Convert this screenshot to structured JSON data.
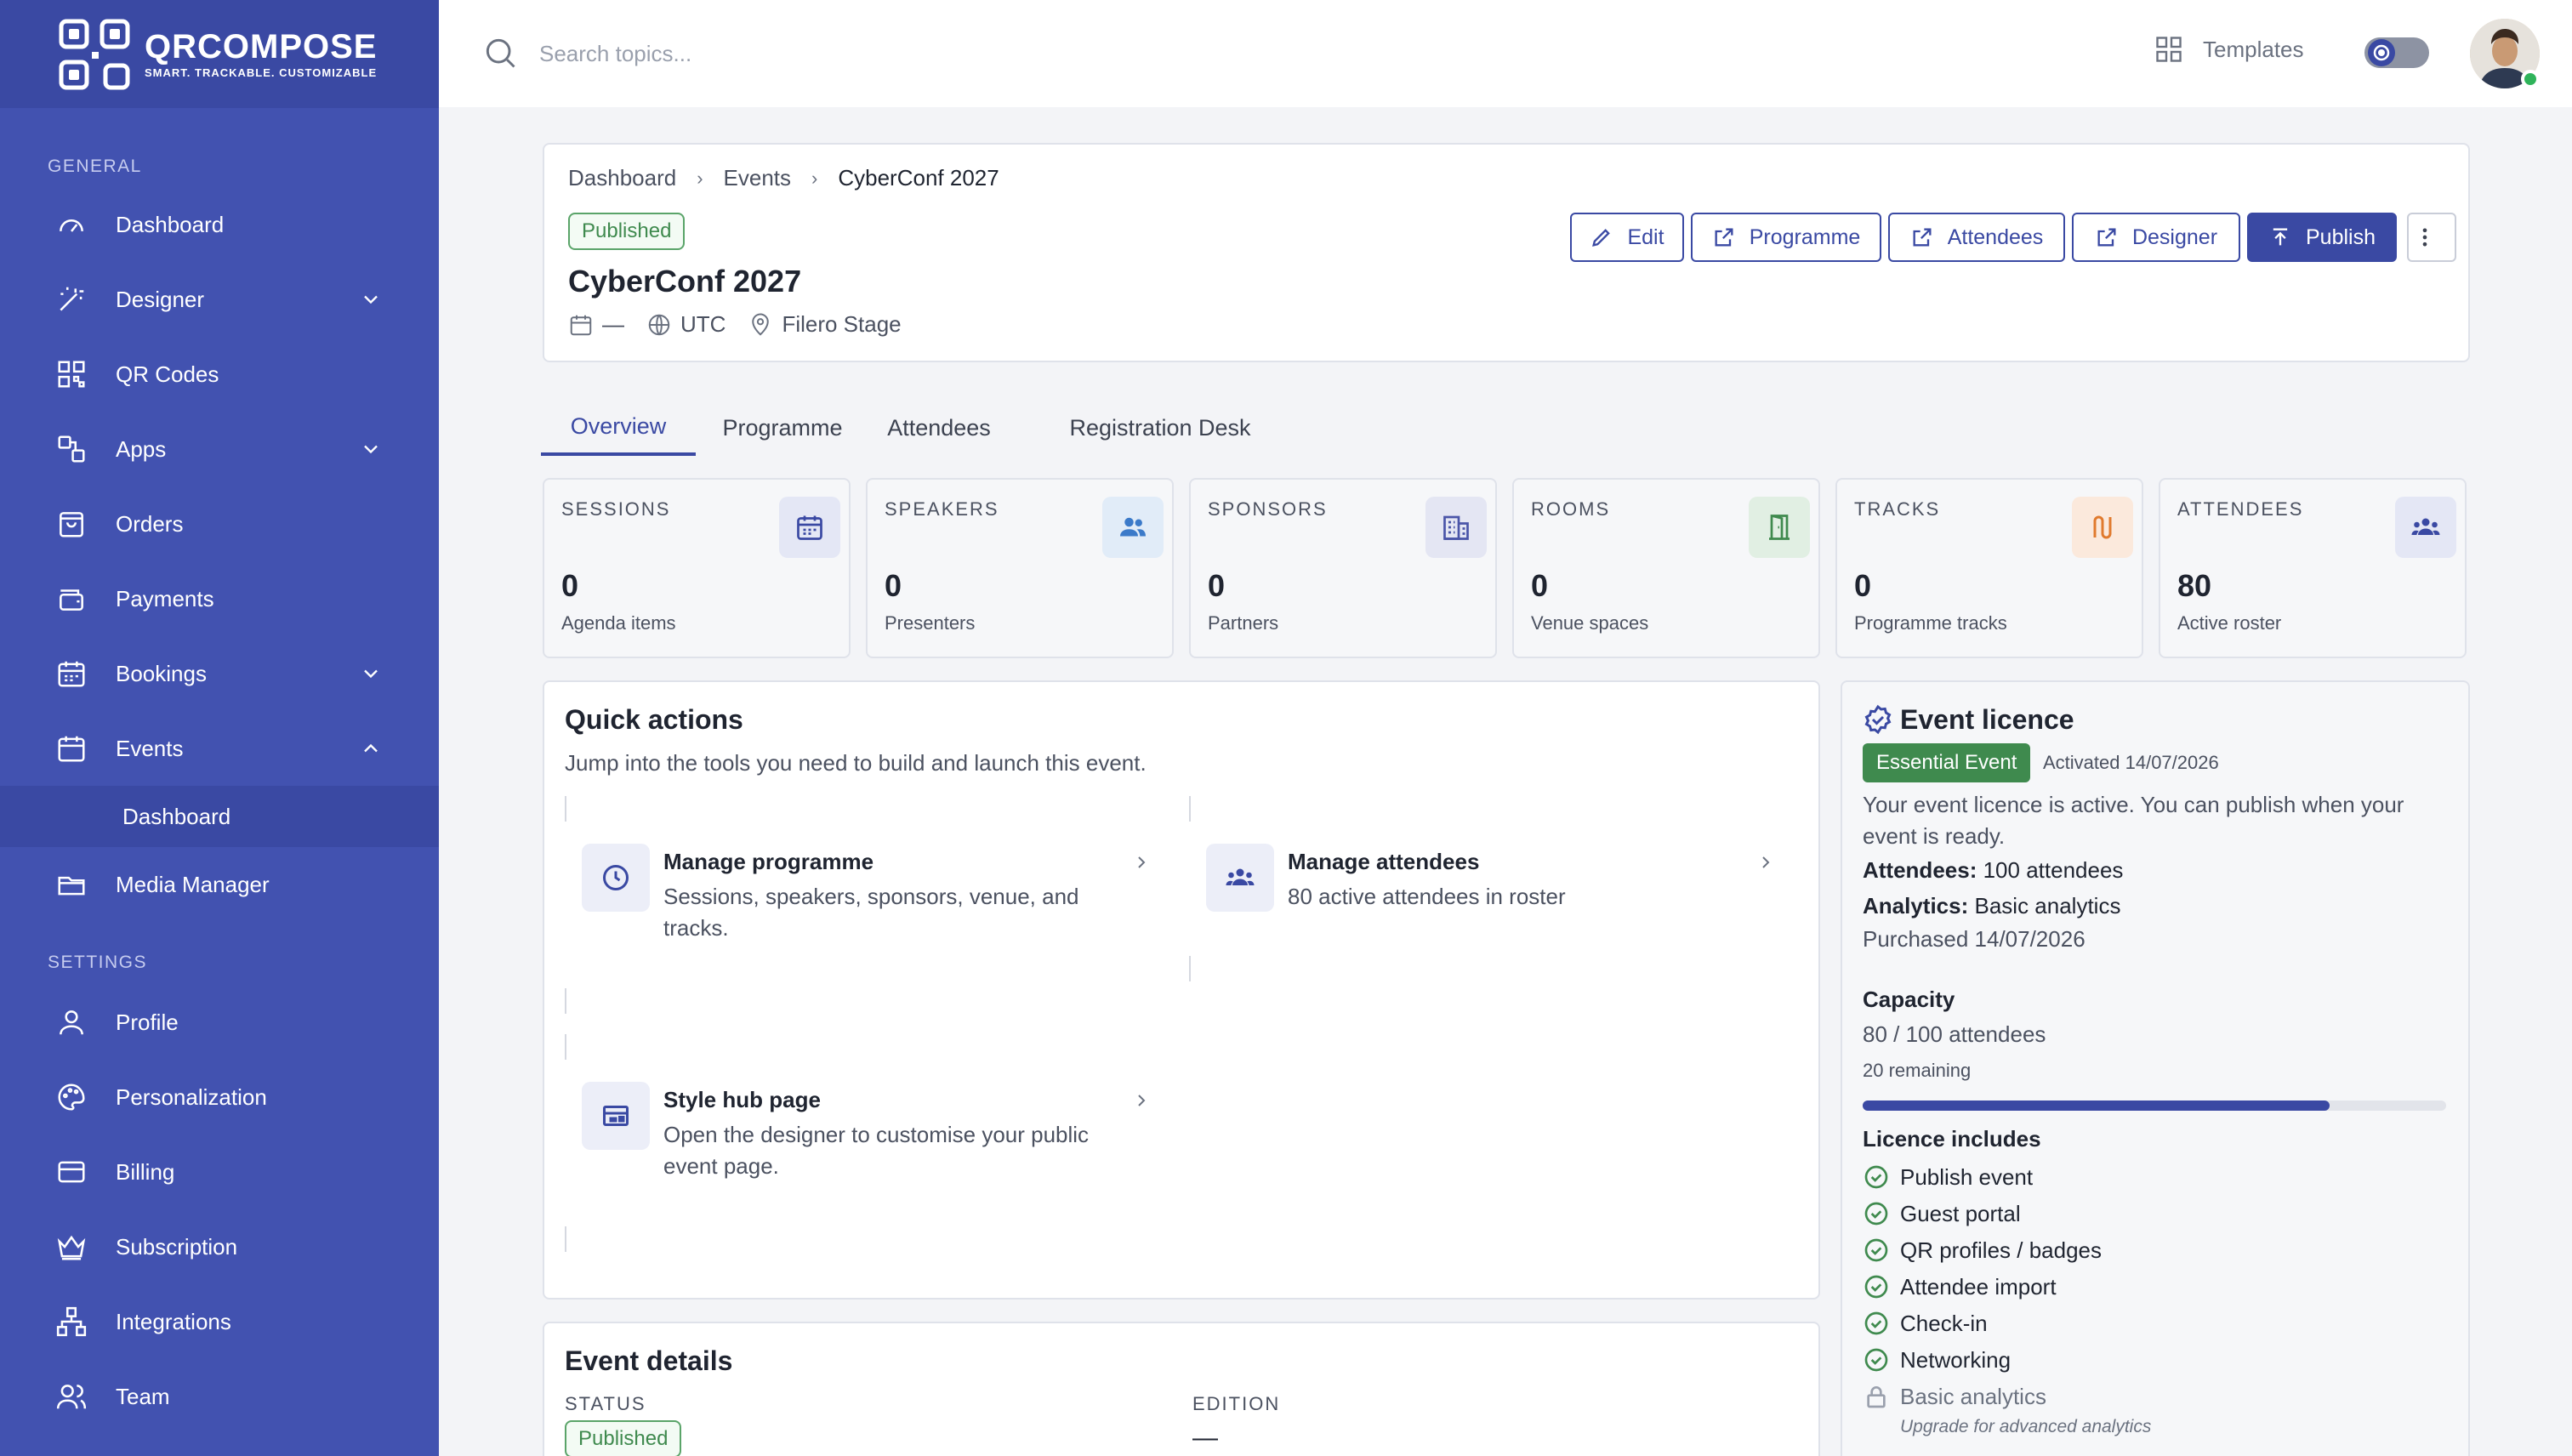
{
  "brand": {
    "name": "QRCOMPOSE",
    "tagline": "SMART. TRACKABLE. CUSTOMIZABLE"
  },
  "sidebar": {
    "general_label": "GENERAL",
    "settings_label": "SETTINGS",
    "items": [
      {
        "label": "Dashboard",
        "icon": "gauge-icon"
      },
      {
        "label": "Designer",
        "icon": "magic-wand-icon"
      },
      {
        "label": "QR Codes",
        "icon": "qr-code-icon"
      },
      {
        "label": "Apps",
        "icon": "apps-icon"
      },
      {
        "label": "Orders",
        "icon": "shopping-bag-icon"
      },
      {
        "label": "Payments",
        "icon": "wallet-icon"
      },
      {
        "label": "Bookings",
        "icon": "calendar-icon"
      },
      {
        "label": "Events",
        "icon": "calendar-event-icon"
      },
      {
        "label": "Media Manager",
        "icon": "folder-icon"
      }
    ],
    "events_sub": {
      "label": "Dashboard"
    },
    "settings_items": [
      {
        "label": "Profile",
        "icon": "user-icon"
      },
      {
        "label": "Personalization",
        "icon": "palette-icon"
      },
      {
        "label": "Billing",
        "icon": "credit-card-icon"
      },
      {
        "label": "Subscription",
        "icon": "crown-icon"
      },
      {
        "label": "Integrations",
        "icon": "network-icon"
      },
      {
        "label": "Team",
        "icon": "team-icon"
      }
    ]
  },
  "topbar": {
    "search_placeholder": "Search topics...",
    "templates_label": "Templates"
  },
  "event": {
    "breadcrumb": [
      "Dashboard",
      "Events",
      "CyberConf 2027"
    ],
    "status": "Published",
    "title": "CyberConf 2027",
    "date": "—",
    "timezone": "UTC",
    "venue": "Filero Stage",
    "actions": {
      "edit": "Edit",
      "programme": "Programme",
      "attendees": "Attendees",
      "designer": "Designer",
      "publish": "Publish"
    }
  },
  "tabs": [
    "Overview",
    "Programme",
    "Attendees",
    "Registration Desk"
  ],
  "stats": [
    {
      "label": "SESSIONS",
      "value": "0",
      "sub": "Agenda items",
      "icon": "calendar-icon",
      "color": "#3a49a3",
      "bg": "#e4e7f5"
    },
    {
      "label": "SPEAKERS",
      "value": "0",
      "sub": "Presenters",
      "icon": "users-icon",
      "color": "#3b7ac9",
      "bg": "#e1ecf8"
    },
    {
      "label": "SPONSORS",
      "value": "0",
      "sub": "Partners",
      "icon": "building-icon",
      "color": "#4a55a8",
      "bg": "#e4e6f3"
    },
    {
      "label": "ROOMS",
      "value": "0",
      "sub": "Venue spaces",
      "icon": "door-icon",
      "color": "#3f8a4e",
      "bg": "#e1efe3"
    },
    {
      "label": "TRACKS",
      "value": "0",
      "sub": "Programme tracks",
      "icon": "route-icon",
      "color": "#e07a2e",
      "bg": "#fbe9dc"
    },
    {
      "label": "ATTENDEES",
      "value": "80",
      "sub": "Active roster",
      "icon": "group-icon",
      "color": "#3a49a3",
      "bg": "#e4e7f5"
    }
  ],
  "quick_actions": {
    "title": "Quick actions",
    "subtitle": "Jump into the tools you need to build and launch this event.",
    "items": [
      {
        "title": "Manage programme",
        "desc": "Sessions, speakers, sponsors, venue, and tracks.",
        "icon": "clock-icon"
      },
      {
        "title": "Manage attendees",
        "desc": "80 active attendees in roster",
        "icon": "group-icon"
      },
      {
        "title": "Style hub page",
        "desc": "Open the designer to customise your public event page.",
        "icon": "layout-icon"
      }
    ]
  },
  "details": {
    "title": "Event details",
    "status_label": "STATUS",
    "status_value": "Published",
    "edition_label": "EDITION",
    "edition_value": "—"
  },
  "licence": {
    "title": "Event licence",
    "plan": "Essential Event",
    "activated": "Activated 14/07/2026",
    "message": "Your event licence is active. You can publish when your event is ready.",
    "attendees_label": "Attendees:",
    "attendees_value": "100 attendees",
    "analytics_label": "Analytics:",
    "analytics_value": "Basic analytics",
    "purchased": "Purchased 14/07/2026",
    "capacity_label": "Capacity",
    "capacity_value": "80 / 100 attendees",
    "remaining": "20 remaining",
    "capacity_fraction": 0.8,
    "includes_label": "Licence includes",
    "features": [
      "Publish event",
      "Guest portal",
      "QR profiles / badges",
      "Attendee import",
      "Check-in",
      "Networking"
    ],
    "locked_feature": "Basic analytics",
    "upgrade_note": "Upgrade for advanced analytics"
  },
  "colors": {
    "primary": "#3a49a3",
    "sidebar": "#4252b0",
    "success": "#3f8a4e"
  }
}
